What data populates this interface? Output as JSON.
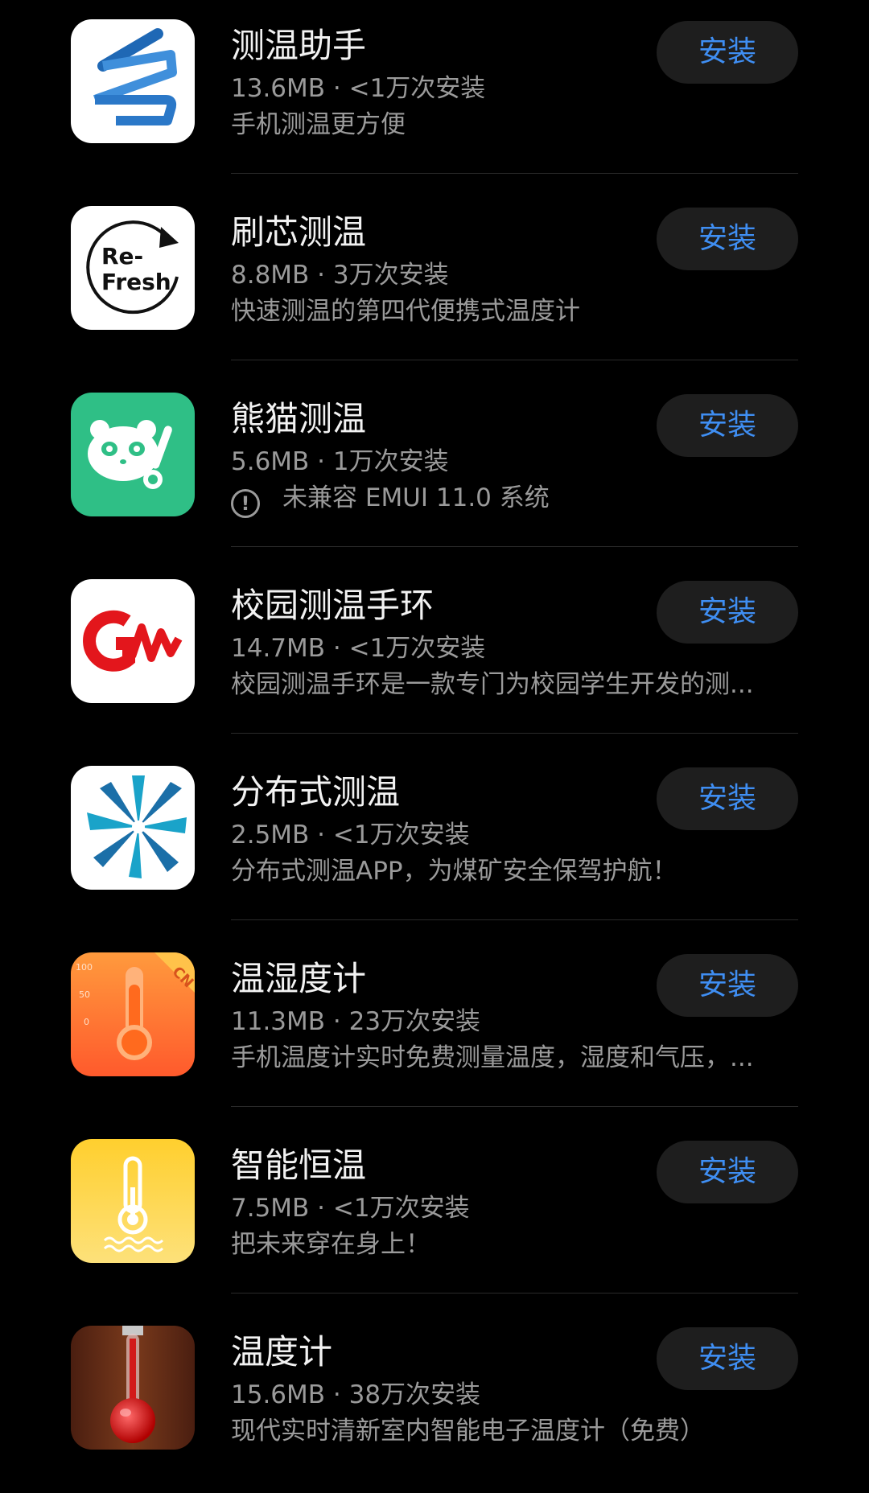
{
  "install_label": "安装",
  "apps": [
    {
      "name": "测温助手",
      "meta": "13.6MB · <1万次安装",
      "desc": "手机测温更方便",
      "warning": false,
      "icon": "zigzag-logo-icon"
    },
    {
      "name": "刷芯测温",
      "meta": "8.8MB · 3万次安装",
      "desc": "快速测温的第四代便携式温度计",
      "warning": false,
      "icon": "refresh-logo-icon",
      "icon_text_1": "Re-",
      "icon_text_2": "Fresh"
    },
    {
      "name": "熊猫测温",
      "meta": "5.6MB · 1万次安装",
      "desc": "未兼容 EMUI 11.0 系统",
      "warning": true,
      "icon": "panda-thermometer-icon"
    },
    {
      "name": "校园测温手环",
      "meta": "14.7MB · <1万次安装",
      "desc": "校园测温手环是一款专门为校园学生开发的测...",
      "warning": false,
      "icon": "red-wave-logo-icon"
    },
    {
      "name": "分布式测温",
      "meta": "2.5MB · <1万次安装",
      "desc": "分布式测温APP，为煤矿安全保驾护航！",
      "warning": false,
      "icon": "blue-fan-logo-icon"
    },
    {
      "name": "温湿度计",
      "meta": "11.3MB · 23万次安装",
      "desc": "手机温度计实时免费测量温度，湿度和气压，...",
      "warning": false,
      "icon": "orange-thermometer-icon",
      "icon_ticks": [
        "100",
        "50",
        "0"
      ],
      "icon_badge": "CN"
    },
    {
      "name": "智能恒温",
      "meta": "7.5MB · <1万次安装",
      "desc": "把未来穿在身上！",
      "warning": false,
      "icon": "yellow-thermometer-icon"
    },
    {
      "name": "温度计",
      "meta": "15.6MB · 38万次安装",
      "desc": "现代实时清新室内智能电子温度计（免费）",
      "warning": false,
      "icon": "wood-thermometer-icon"
    }
  ],
  "colors": {
    "background": "#000000",
    "install_text": "#3f8ef2",
    "install_bg": "#1e1e1e",
    "secondary_text": "#9a9a9a"
  }
}
